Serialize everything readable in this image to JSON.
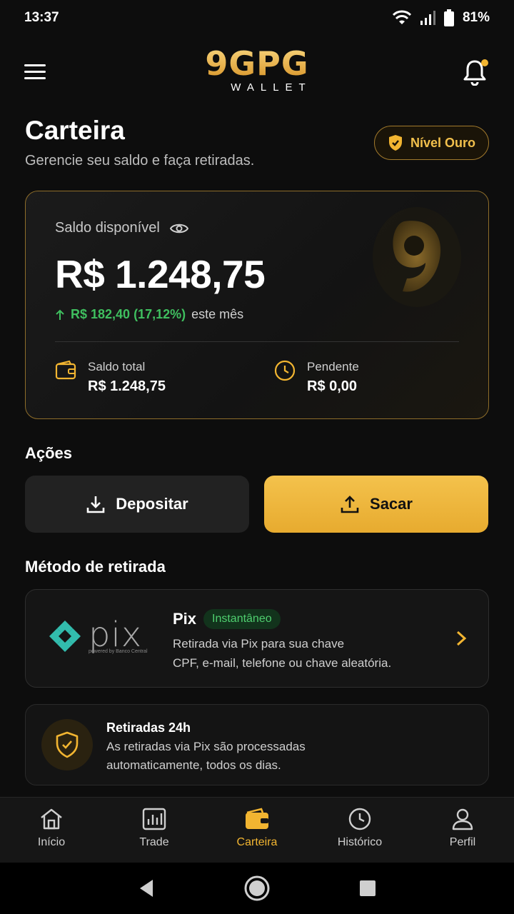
{
  "status": {
    "time": "13:37",
    "battery": "81%"
  },
  "header": {
    "logo_main": "9GPG",
    "logo_sub": "WALLET"
  },
  "page": {
    "title": "Carteira",
    "subtitle": "Gerencie seu saldo e faça retiradas.",
    "level_badge": "Nível Ouro"
  },
  "balance": {
    "label": "Saldo disponível",
    "value": "R$ 1.248,75",
    "change": "R$ 182,40 (17,12%)",
    "change_suffix": "este mês",
    "total_label": "Saldo total",
    "total_value": "R$ 1.248,75",
    "pending_label": "Pendente",
    "pending_value": "R$ 0,00"
  },
  "actions": {
    "title": "Ações",
    "deposit": "Depositar",
    "withdraw": "Sacar"
  },
  "method": {
    "title": "Método de retirada",
    "logo_word": "pix",
    "logo_small": "powered by Banco Central",
    "name": "Pix",
    "badge": "Instantâneo",
    "desc_line1": "Retirada via Pix para sua chave",
    "desc_line2": "CPF, e-mail, telefone ou chave aleatória."
  },
  "info": {
    "title": "Retiradas 24h",
    "desc_line1": "As retiradas via Pix são processadas",
    "desc_line2": "automaticamente, todos os dias."
  },
  "nav": {
    "items": [
      {
        "label": "Início",
        "icon": "home-icon"
      },
      {
        "label": "Trade",
        "icon": "chart-icon"
      },
      {
        "label": "Carteira",
        "icon": "wallet-icon"
      },
      {
        "label": "Histórico",
        "icon": "clock-icon"
      },
      {
        "label": "Perfil",
        "icon": "user-icon"
      }
    ],
    "active_index": 2
  },
  "colors": {
    "accent": "#f2b531",
    "positive": "#3fbf5f",
    "background": "#0d0d0d"
  }
}
